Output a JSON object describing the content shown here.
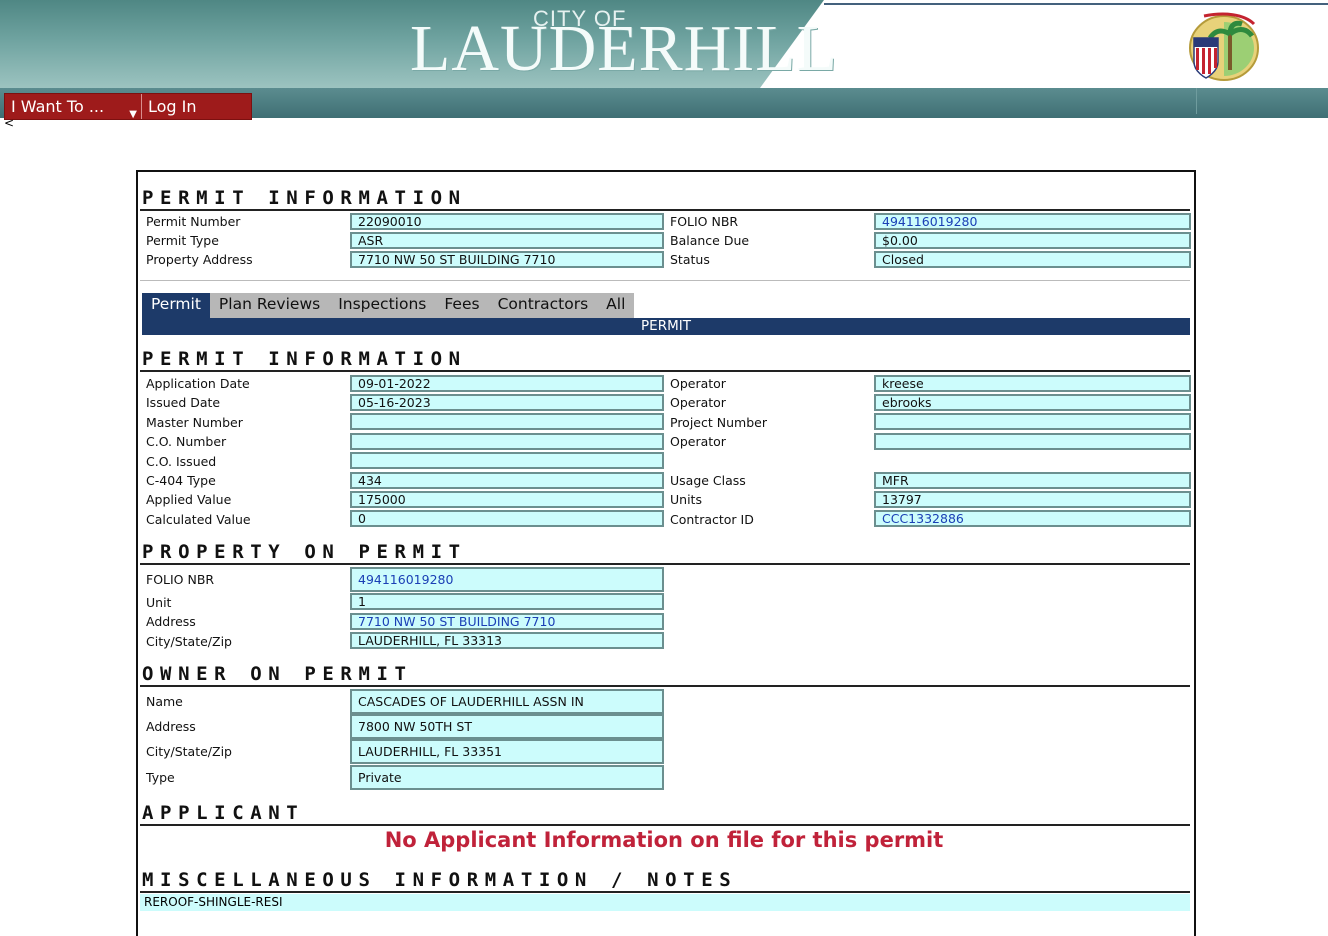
{
  "header": {
    "city_of": "CITY OF",
    "logo": "LAUDERHILL",
    "seal_icon": "city-seal-icon"
  },
  "menu": {
    "i_want_to": "I Want To ...",
    "log_in": "Log In",
    "back_glyph": "<"
  },
  "permit_info": {
    "title": "PERMIT INFORMATION",
    "rows": [
      {
        "label": "Permit Number",
        "value": "22090010",
        "label2": "FOLIO NBR",
        "value2": "494116019280"
      },
      {
        "label": "Permit Type",
        "value": "ASR",
        "label2": "Balance Due",
        "value2": "$0.00"
      },
      {
        "label": "Property Address",
        "value": "7710 NW 50 ST BUILDING 7710",
        "label2": "Status",
        "value2": "Closed"
      }
    ]
  },
  "tabs": [
    "Permit",
    "Plan Reviews",
    "Inspections",
    "Fees",
    "Contractors",
    "All"
  ],
  "permit_bar": "PERMIT",
  "detail": {
    "title": "PERMIT INFORMATION",
    "left": [
      {
        "label": "Application Date",
        "value": "09-01-2022"
      },
      {
        "label": "Issued Date",
        "value": "05-16-2023"
      },
      {
        "label": "Master Number",
        "value": ""
      },
      {
        "label": "C.O. Number",
        "value": ""
      },
      {
        "label": "C.O. Issued",
        "value": ""
      },
      {
        "label": "C-404 Type",
        "value": "434"
      },
      {
        "label": "Applied Value",
        "value": "175000"
      },
      {
        "label": "Calculated Value",
        "value": "0"
      }
    ],
    "right": [
      {
        "label": "Operator",
        "value": "kreese"
      },
      {
        "label": "Operator",
        "value": "ebrooks"
      },
      {
        "label": "Project Number",
        "value": ""
      },
      {
        "label": "Operator",
        "value": ""
      },
      {
        "label": "Usage Class",
        "value": "MFR"
      },
      {
        "label": "Units",
        "value": "13797"
      },
      {
        "label": "Contractor ID",
        "value": "CCC1332886"
      }
    ]
  },
  "property": {
    "title": "PROPERTY ON PERMIT",
    "rows": [
      {
        "label": "FOLIO NBR",
        "value": "494116019280"
      },
      {
        "label": "Unit",
        "value": "1"
      },
      {
        "label": "Address",
        "value": "7710 NW 50 ST BUILDING 7710"
      },
      {
        "label": "City/State/Zip",
        "value": "LAUDERHILL, FL 33313"
      }
    ]
  },
  "owner": {
    "title": "OWNER ON PERMIT",
    "rows": [
      {
        "label": "Name",
        "value": "CASCADES OF LAUDERHILL ASSN IN"
      },
      {
        "label": "Address",
        "value": "7800 NW 50TH ST"
      },
      {
        "label": "City/State/Zip",
        "value": "LAUDERHILL, FL 33351"
      },
      {
        "label": "Type",
        "value": "Private"
      }
    ]
  },
  "applicant": {
    "title": "APPLICANT",
    "message": "No Applicant Information on file for this permit"
  },
  "misc": {
    "title": "MISCELLANEOUS INFORMATION / NOTES",
    "value": "REROOF-SHINGLE-RESI"
  }
}
